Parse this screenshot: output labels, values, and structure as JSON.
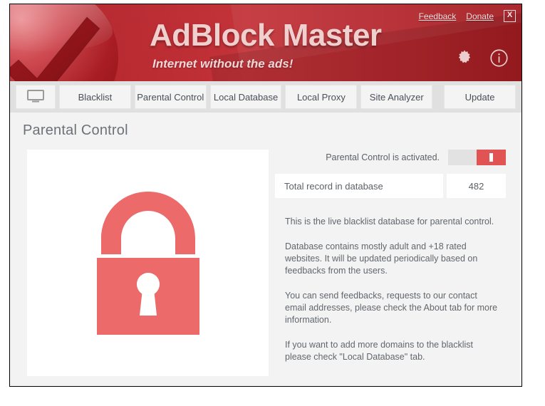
{
  "header": {
    "title": "AdBlock Master",
    "tagline": "Internet without the ads!",
    "links": [
      {
        "label": "Feedback",
        "name": "feedback-link"
      },
      {
        "label": "Donate",
        "name": "donate-link"
      }
    ],
    "close_label": "X",
    "icons": [
      {
        "name": "gear-icon",
        "label": "Settings"
      },
      {
        "name": "info-icon",
        "label": "About"
      }
    ],
    "logo_icon": "checkmark-logo-icon"
  },
  "tabs": [
    {
      "label": "",
      "icon": "monitor-icon",
      "name": "tab-home",
      "active": false
    },
    {
      "label": "Blacklist",
      "name": "tab-blacklist",
      "active": false
    },
    {
      "label": "Parental Control",
      "name": "tab-parental-control",
      "active": true
    },
    {
      "label": "Local Database",
      "name": "tab-local-database",
      "active": false
    },
    {
      "label": "Local Proxy",
      "name": "tab-local-proxy",
      "active": false
    },
    {
      "label": "Site Analyzer",
      "name": "tab-site-analyzer",
      "active": false
    },
    {
      "label": "Update",
      "name": "tab-update",
      "active": false
    }
  ],
  "page": {
    "title": "Parental Control",
    "illustration_icon": "padlock-icon",
    "toggle": {
      "label": "Parental Control is activated.",
      "state": "on",
      "accent_color": "#e25353"
    },
    "record": {
      "label": "Total record in database",
      "value": "482"
    },
    "paragraphs": [
      "This is the live blacklist database for parental control.",
      "Database contains mostly adult and +18 rated websites. It will be updated periodically based on feedbacks from the users.",
      "You can send feedbacks, requests to our contact email addresses, please check the About tab for more information.",
      "If you want to add more domains to the blacklist please check \"Local Database\" tab."
    ]
  },
  "colors": {
    "brand_red": "#b52229",
    "accent_red": "#e25353",
    "panel_bg": "#f3f3f3",
    "tabbar_bg": "#e0e0e0"
  }
}
